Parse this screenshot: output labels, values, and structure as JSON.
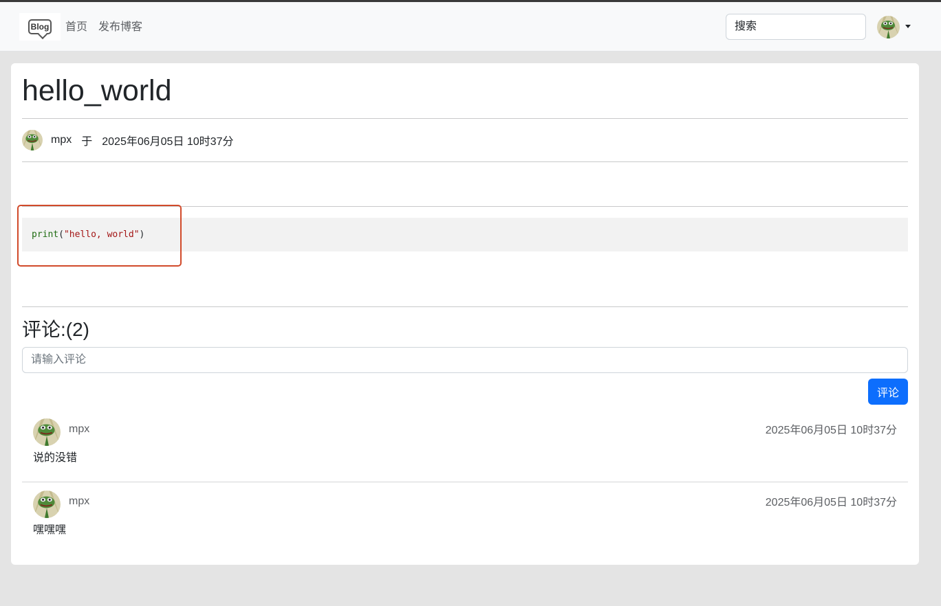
{
  "navbar": {
    "logo_text": "Blog",
    "links": [
      "首页",
      "发布博客"
    ],
    "search_placeholder": "搜索"
  },
  "post": {
    "title": "hello_world",
    "author": "mpx",
    "preposition": "于",
    "published": "2025年06月05日 10时37分",
    "code": {
      "fn": "print",
      "open": "(",
      "string": "\"hello, world\"",
      "close": ")"
    }
  },
  "comments_section": {
    "heading": "评论:(2)",
    "input_placeholder": "请输入评论",
    "submit_label": "评论",
    "items": [
      {
        "user": "mpx",
        "time": "2025年06月05日 10时37分",
        "text": "说的没错"
      },
      {
        "user": "mpx",
        "time": "2025年06月05日 10时37分",
        "text": "嘿嘿嘿"
      }
    ]
  },
  "colors": {
    "primary_button": "#0d6efd",
    "annotation_box": "#d14a2a",
    "navbar_bg": "#f8f9fa",
    "page_bg": "#e4e4e4"
  },
  "icons": {
    "avatar": "frog-avatar-icon",
    "dropdown": "caret-down-icon"
  }
}
